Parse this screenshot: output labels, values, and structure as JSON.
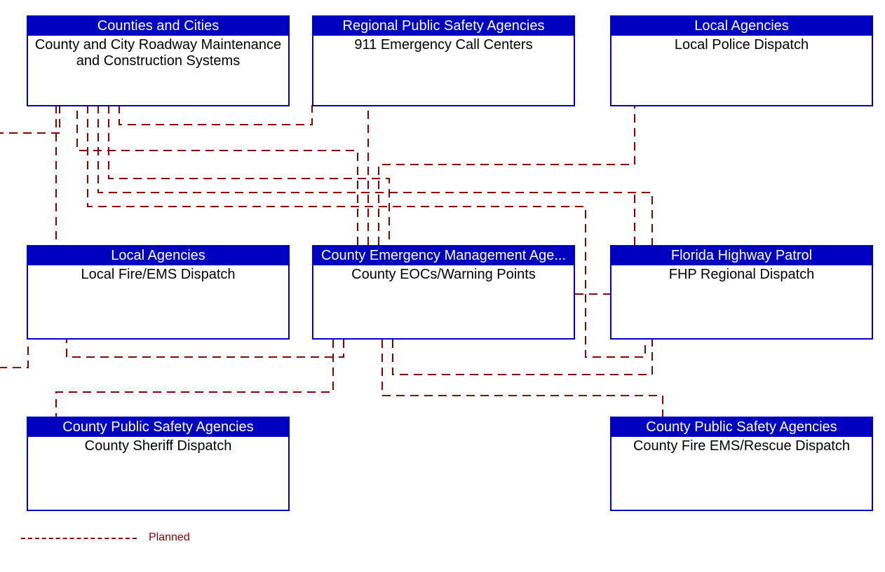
{
  "nodes": {
    "counties_cities": {
      "header": "Counties and Cities",
      "body": "County and City Roadway Maintenance and Construction Systems"
    },
    "regional_psa": {
      "header": "Regional Public Safety Agencies",
      "body": "911 Emergency Call Centers"
    },
    "local_police": {
      "header": "Local Agencies",
      "body": "Local Police Dispatch"
    },
    "local_fire": {
      "header": "Local Agencies",
      "body": "Local Fire/EMS Dispatch"
    },
    "county_em": {
      "header": "County Emergency Management Age...",
      "body": "County EOCs/Warning Points"
    },
    "fhp": {
      "header": "Florida Highway Patrol",
      "body": "FHP Regional Dispatch"
    },
    "county_sheriff": {
      "header": "County Public Safety Agencies",
      "body": "County Sheriff Dispatch"
    },
    "county_fire_ems": {
      "header": "County Public Safety Agencies",
      "body": "County Fire EMS/Rescue Dispatch"
    }
  },
  "legend": {
    "label": "Planned"
  },
  "connections": [
    {
      "from": "county_em",
      "to": "counties_cities",
      "status": "planned"
    },
    {
      "from": "county_em",
      "to": "regional_psa",
      "status": "planned"
    },
    {
      "from": "county_em",
      "to": "local_police",
      "status": "planned"
    },
    {
      "from": "county_em",
      "to": "local_fire",
      "status": "planned"
    },
    {
      "from": "county_em",
      "to": "fhp",
      "status": "planned"
    },
    {
      "from": "county_em",
      "to": "county_sheriff",
      "status": "planned"
    },
    {
      "from": "county_em",
      "to": "county_fire_ems",
      "status": "planned"
    },
    {
      "from": "counties_cities",
      "to": "local_fire",
      "status": "planned"
    },
    {
      "from": "counties_cities",
      "to": "county_sheriff",
      "status": "planned"
    },
    {
      "from": "counties_cities",
      "to": "fhp",
      "status": "planned"
    },
    {
      "from": "counties_cities",
      "to": "local_police",
      "status": "planned"
    },
    {
      "from": "counties_cities",
      "to": "county_fire_ems",
      "status": "planned"
    },
    {
      "from": "counties_cities",
      "to": "offscreen_left_1",
      "status": "planned"
    },
    {
      "from": "local_fire",
      "to": "offscreen_left_2",
      "status": "planned"
    }
  ],
  "colors": {
    "node_border": "#0000c0",
    "node_header_bg": "#0000c0",
    "node_header_fg": "#ffffff",
    "planned_line": "#8b0000"
  }
}
